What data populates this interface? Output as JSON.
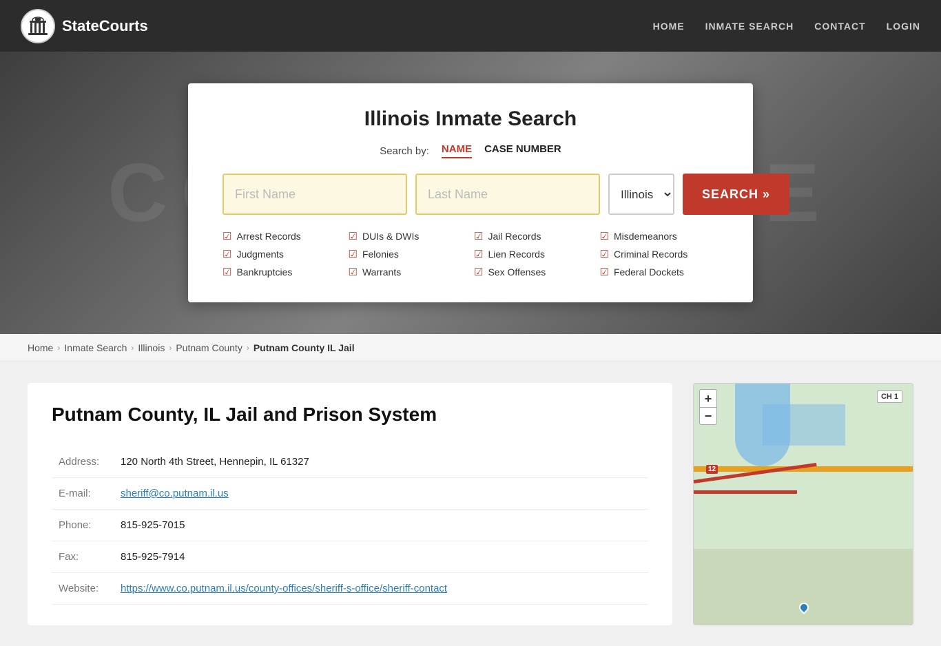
{
  "site": {
    "name": "StateCourts"
  },
  "nav": {
    "home": "HOME",
    "inmate_search": "INMATE SEARCH",
    "contact": "CONTACT",
    "login": "LOGIN"
  },
  "hero_bg_text": "COURTHOUSE",
  "search_card": {
    "title": "Illinois Inmate Search",
    "search_by_label": "Search by:",
    "tab_name": "NAME",
    "tab_case_number": "CASE NUMBER",
    "first_name_placeholder": "First Name",
    "last_name_placeholder": "Last Name",
    "state_default": "Illinois",
    "search_button": "SEARCH »",
    "checks": [
      "Arrest Records",
      "DUIs & DWIs",
      "Jail Records",
      "Misdemeanors",
      "Judgments",
      "Felonies",
      "Lien Records",
      "Criminal Records",
      "Bankruptcies",
      "Warrants",
      "Sex Offenses",
      "Federal Dockets"
    ]
  },
  "breadcrumb": {
    "home": "Home",
    "inmate_search": "Inmate Search",
    "state": "Illinois",
    "county": "Putnam County",
    "current": "Putnam County IL Jail"
  },
  "facility": {
    "title": "Putnam County, IL Jail and Prison System",
    "address_label": "Address:",
    "address_value": "120 North 4th Street, Hennepin, IL 61327",
    "email_label": "E-mail:",
    "email_value": "sheriff@co.putnam.il.us",
    "phone_label": "Phone:",
    "phone_value": "815-925-7015",
    "fax_label": "Fax:",
    "fax_value": "815-925-7914",
    "website_label": "Website:",
    "website_value": "https://www.co.putnam.il.us/county-offices/sheriff-s-office/sheriff-contact"
  },
  "map": {
    "plus": "+",
    "minus": "−",
    "label_ch1": "CH 1",
    "road_num": "12"
  }
}
